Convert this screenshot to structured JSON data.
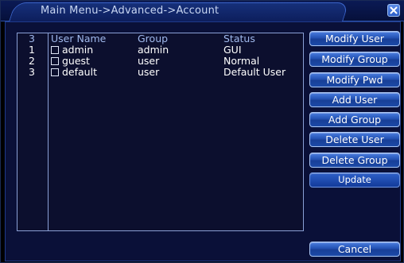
{
  "window": {
    "title": "Main Menu->Advanced->Account"
  },
  "table": {
    "header": {
      "count": "3",
      "user_name": "User Name",
      "group": "Group",
      "status": "Status"
    },
    "rows": [
      {
        "num": "1",
        "name": "admin",
        "group": "admin",
        "status": "GUI"
      },
      {
        "num": "2",
        "name": "guest",
        "group": "user",
        "status": "Normal"
      },
      {
        "num": "3",
        "name": "default",
        "group": "user",
        "status": "Default User"
      }
    ]
  },
  "buttons": {
    "modify_user": "Modify User",
    "modify_group": "Modify Group",
    "modify_pwd": "Modify Pwd",
    "add_user": "Add User",
    "add_group": "Add Group",
    "delete_user": "Delete User",
    "delete_group": "Delete Group",
    "update": "Update",
    "cancel": "Cancel"
  },
  "colors": {
    "accent": "#2351b3",
    "background": "#0a1038",
    "header_text": "#9fb8ec"
  }
}
